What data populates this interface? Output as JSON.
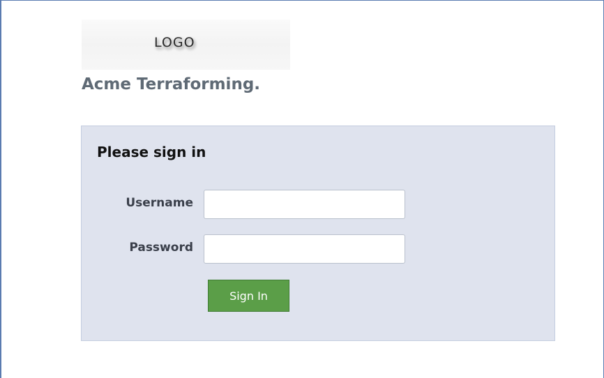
{
  "header": {
    "logo_text": "LOGO",
    "company_name": "Acme Terraforming."
  },
  "signin": {
    "title": "Please sign in",
    "username_label": "Username",
    "password_label": "Password",
    "username_value": "",
    "password_value": "",
    "button_label": "Sign In"
  },
  "colors": {
    "panel_background": "#dfe3ee",
    "button_background": "#5b9e48",
    "company_name_text": "#5f6a75"
  }
}
